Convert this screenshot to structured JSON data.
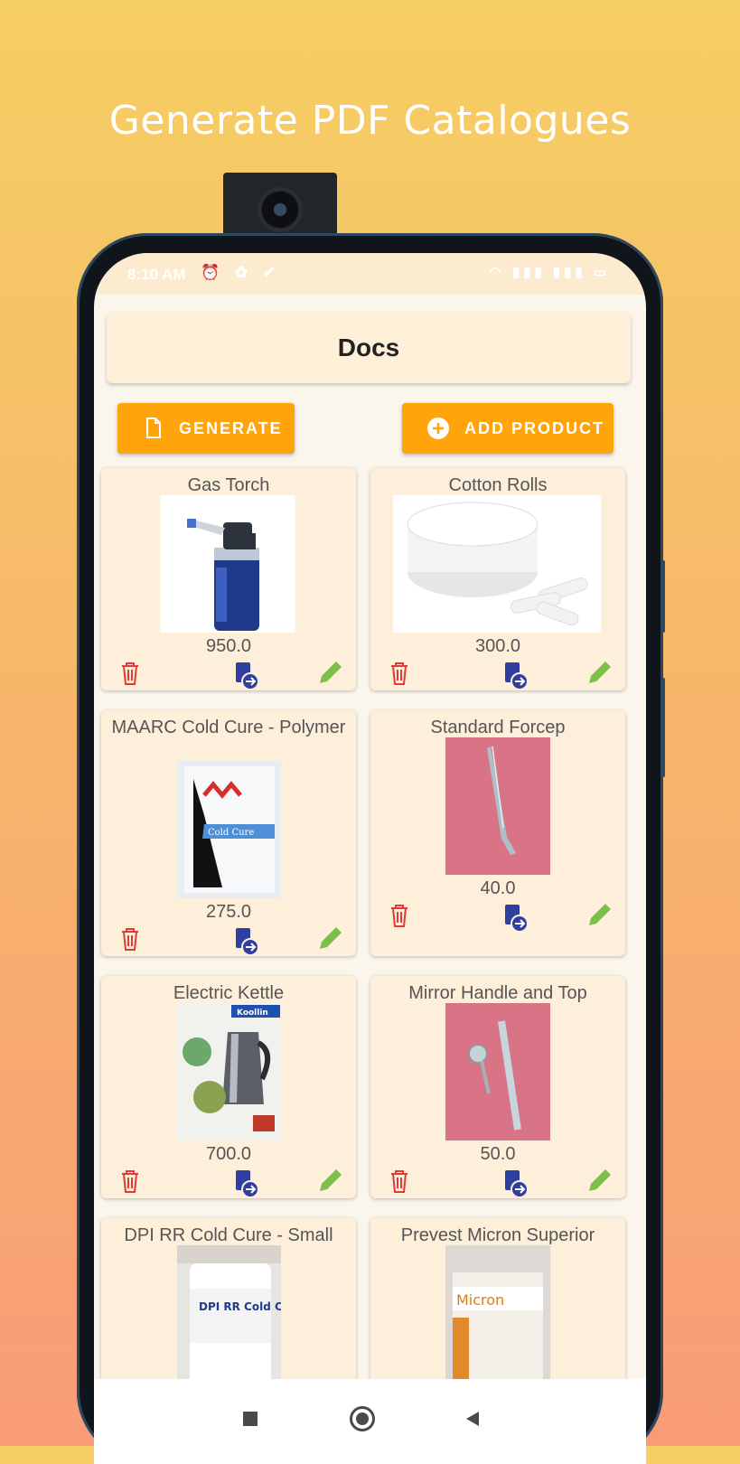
{
  "headline": "Generate PDF Catalogues",
  "status": {
    "time": "8:10 AM"
  },
  "appbar": {
    "title": "Docs"
  },
  "buttons": {
    "generate": "GENERATE",
    "add_product": "ADD PRODUCT"
  },
  "colors": {
    "accent": "#FFA40A",
    "delete": "#E53935",
    "share": "#2E3FA0",
    "edit": "#7CC04B",
    "card": "#FDEFDA"
  },
  "products": [
    {
      "name": "Gas Torch",
      "price": "950.0"
    },
    {
      "name": "Cotton Rolls",
      "price": "300.0"
    },
    {
      "name": "MAARC Cold Cure - Polymer",
      "price": "275.0",
      "label_text": "Cold Cure"
    },
    {
      "name": "Standard Forcep",
      "price": "40.0"
    },
    {
      "name": "Electric Kettle",
      "price": "700.0",
      "label_text": "Koollin"
    },
    {
      "name": "Mirror Handle and Top",
      "price": "50.0"
    },
    {
      "name": "DPI RR Cold Cure - Small",
      "label_text": "DPI RR Cold Cure"
    },
    {
      "name": "Prevest Micron Superior",
      "label_text": "Micron"
    }
  ],
  "icons": {
    "delete": "trash-icon",
    "share": "share-icon",
    "edit": "pencil-icon",
    "home": "circle-home-icon",
    "recents": "square-icon",
    "back": "triangle-back-icon"
  }
}
